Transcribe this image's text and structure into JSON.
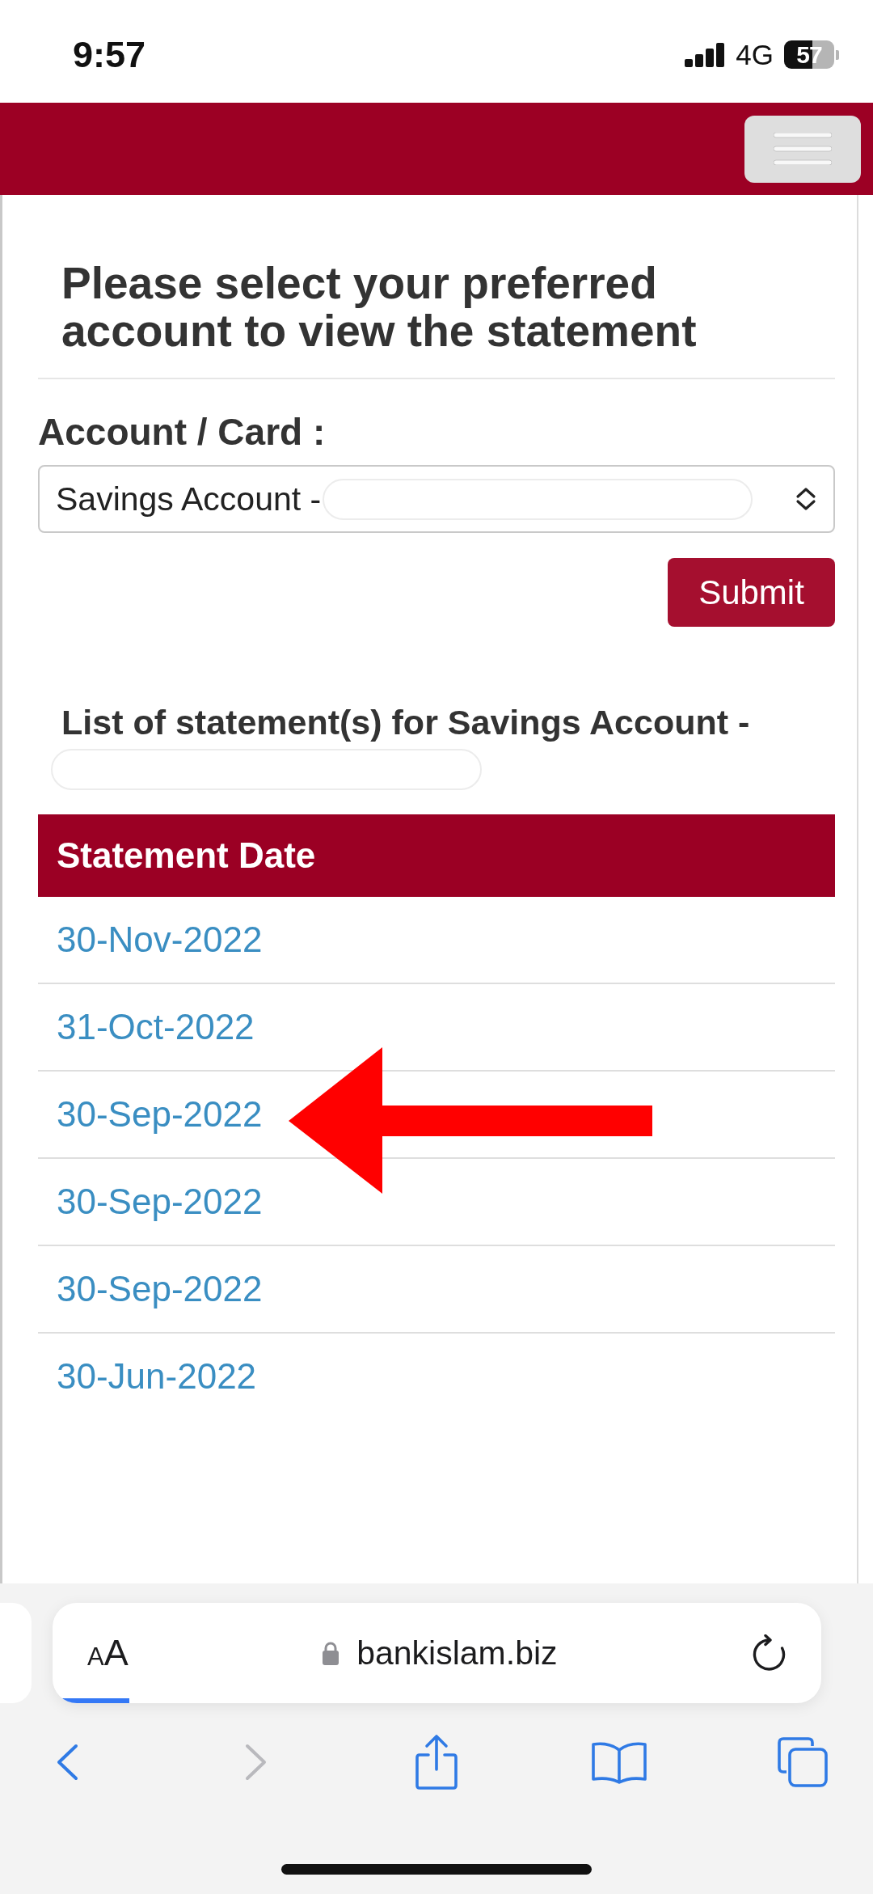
{
  "status_bar": {
    "time": "9:57",
    "network": "4G",
    "battery": "57"
  },
  "form": {
    "heading": "Please select your preferred account to view the statement",
    "account_label": "Account / Card :",
    "account_select": {
      "value": "Savings Account -"
    },
    "submit_label": "Submit"
  },
  "statements": {
    "heading": "List of statement(s) for Savings Account -",
    "column_header": "Statement Date",
    "rows": [
      {
        "date": "30-Nov-2022",
        "marked_by_arrow": false
      },
      {
        "date": "31-Oct-2022",
        "marked_by_arrow": false
      },
      {
        "date": "30-Sep-2022",
        "marked_by_arrow": true
      },
      {
        "date": "30-Sep-2022",
        "marked_by_arrow": false
      },
      {
        "date": "30-Sep-2022",
        "marked_by_arrow": false
      },
      {
        "date": "30-Jun-2022",
        "marked_by_arrow": false
      }
    ]
  },
  "browser": {
    "text_size": {
      "small": "A",
      "large": "A"
    },
    "domain": "bankislam.biz",
    "load_progress": {
      "level": 0.1
    },
    "back_disabled": false,
    "forward_disabled": true
  }
}
